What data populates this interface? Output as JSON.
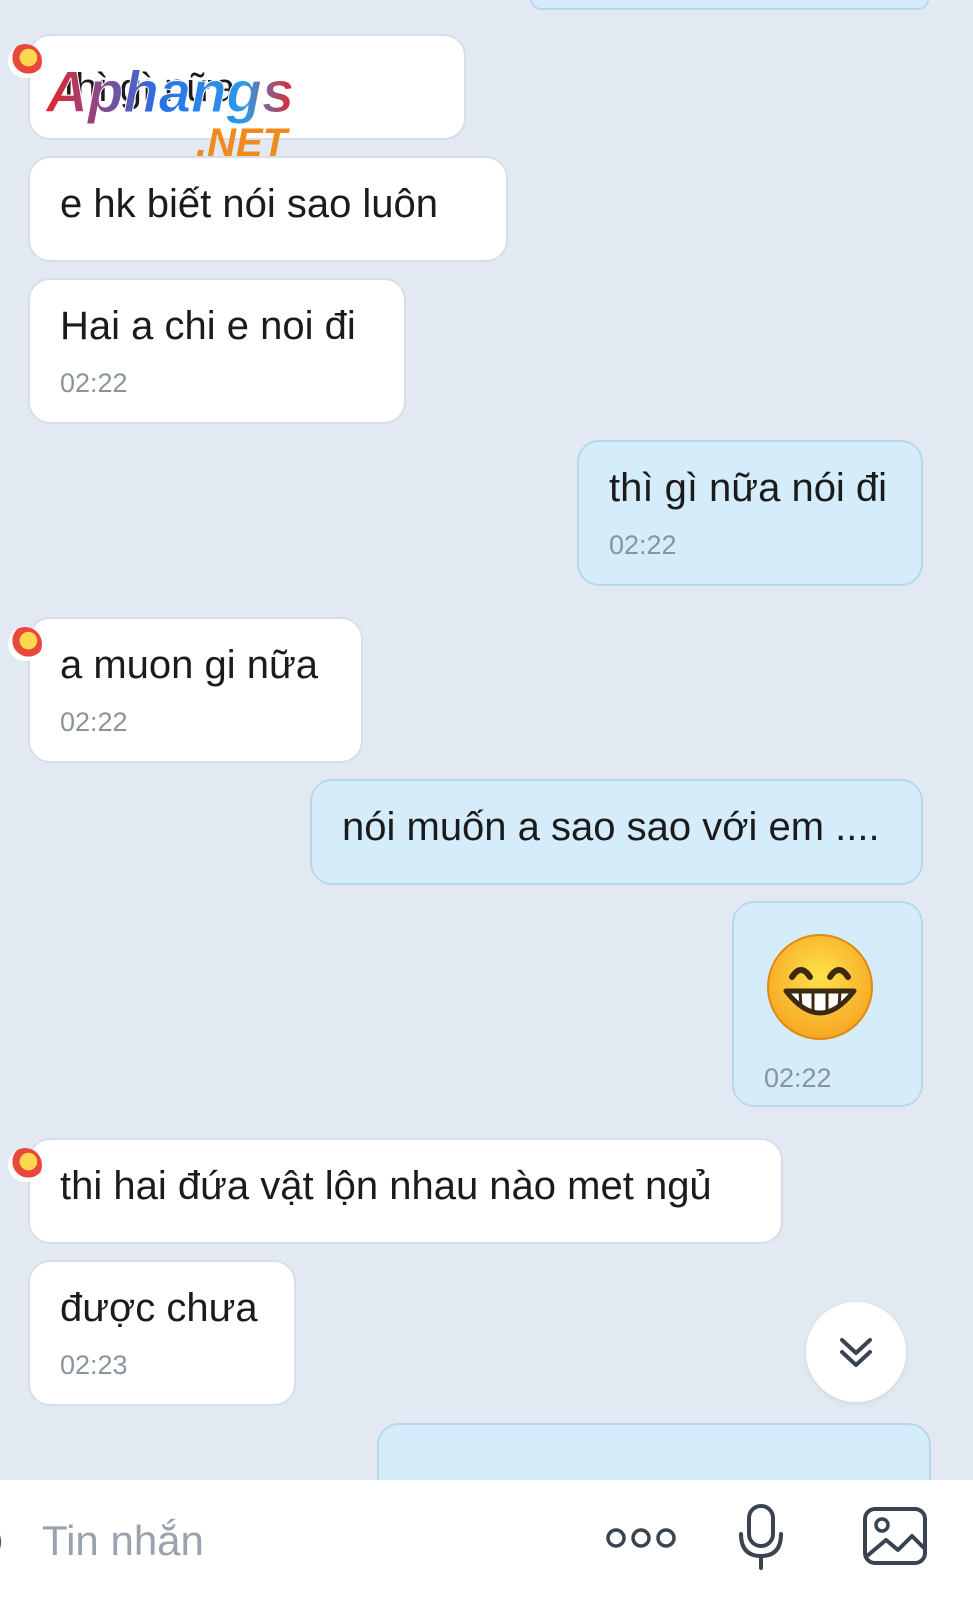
{
  "watermark": {
    "brand": "Aphangs",
    "suffix": ".NET"
  },
  "messages": [
    {
      "side": "in",
      "text": "thì gì nữa",
      "time": ""
    },
    {
      "side": "in",
      "text": "e hk biết nói sao  luôn",
      "time": ""
    },
    {
      "side": "in",
      "text": "Hai a chi e noi đi",
      "time": "02:22"
    },
    {
      "side": "out",
      "text": "thì gì nữa nói đi",
      "time": "02:22"
    },
    {
      "side": "in",
      "text": "a muon gi nữa",
      "time": "02:22"
    },
    {
      "side": "out",
      "text": "nói muốn a sao sao với em ....",
      "time": ""
    },
    {
      "side": "out",
      "text": "",
      "emoji": "grinning-face",
      "time": "02:22"
    },
    {
      "side": "in",
      "text": "thi hai đứa vật lộn nhau nào met ngủ",
      "time": ""
    },
    {
      "side": "in",
      "text": "được chưa",
      "time": "02:23"
    }
  ],
  "input": {
    "placeholder": "Tin nhắn"
  },
  "icons": {
    "scroll_down": "chevron-double-down-icon",
    "more": "more-icon",
    "mic": "microphone-icon",
    "image": "image-icon"
  },
  "colors": {
    "background": "#e2e9f3",
    "incoming_bubble": "#ffffff",
    "outgoing_bubble": "#d5ecfb",
    "timestamp": "#8a949f"
  }
}
